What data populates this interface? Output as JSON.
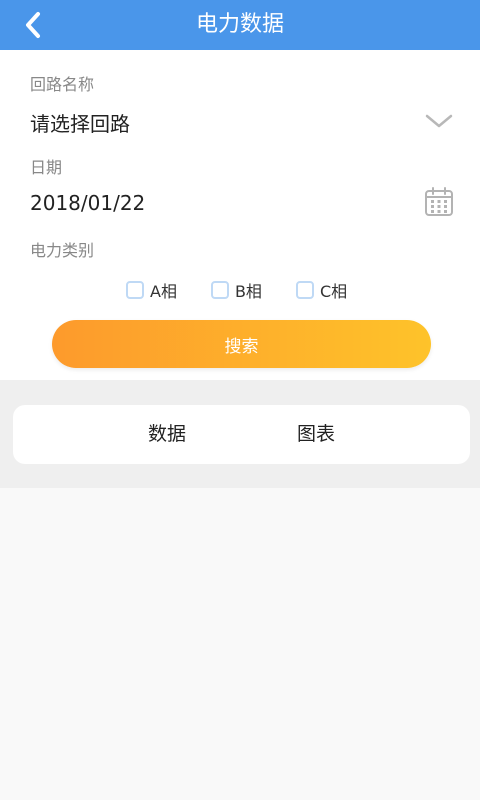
{
  "header": {
    "title": "电力数据",
    "back_icon": "chevron-left-icon"
  },
  "form": {
    "loop": {
      "label": "回路名称",
      "value": "请选择回路",
      "icon": "chevron-down-icon"
    },
    "date": {
      "label": "日期",
      "value": "2018/01/22",
      "icon": "calendar-icon"
    },
    "type": {
      "label": "电力类别",
      "options": [
        {
          "label": "A相",
          "checked": false
        },
        {
          "label": "B相",
          "checked": false
        },
        {
          "label": "C相",
          "checked": false
        }
      ]
    },
    "search_label": "搜索"
  },
  "tabs": {
    "items": [
      {
        "label": "数据"
      },
      {
        "label": "图表"
      }
    ]
  },
  "colors": {
    "header_bg": "#4a96ea",
    "button_gradient_start": "#fd9a2c",
    "button_gradient_end": "#fec32a",
    "checkbox_border": "#bfd9f5"
  }
}
